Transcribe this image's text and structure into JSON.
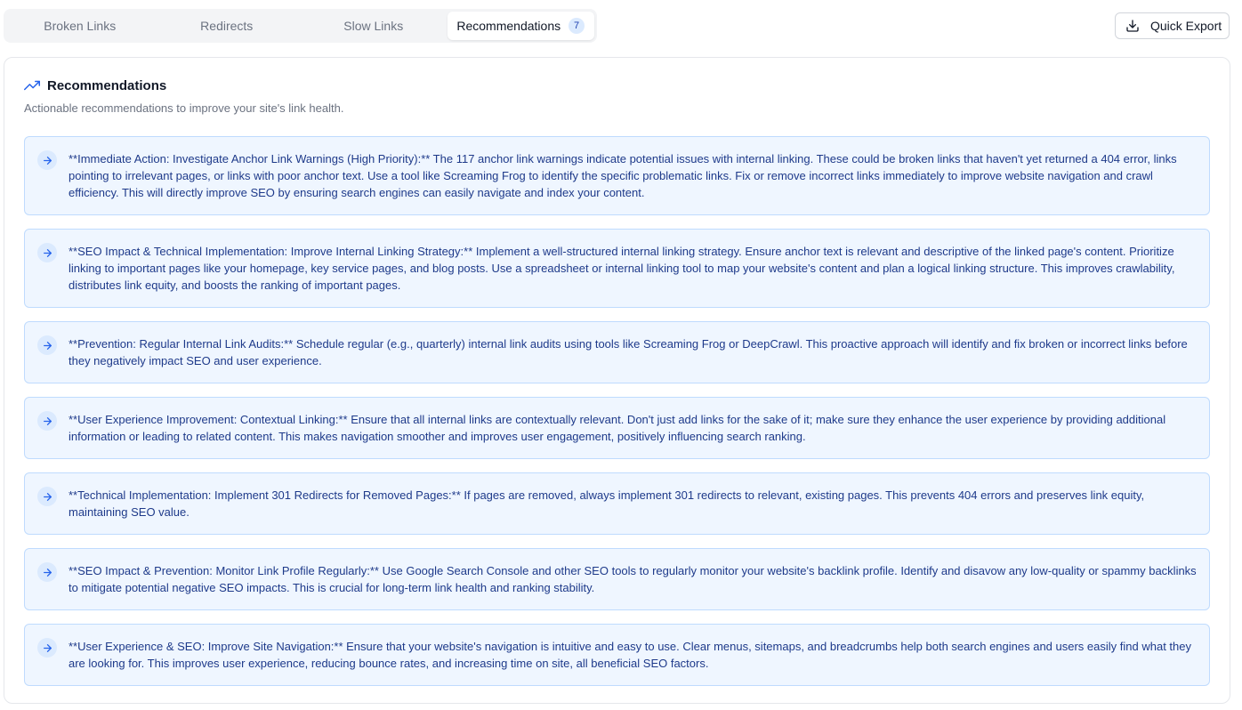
{
  "tabs": [
    {
      "label": "Broken Links"
    },
    {
      "label": "Redirects"
    },
    {
      "label": "Slow Links"
    },
    {
      "label": "Recommendations",
      "badge": "7"
    }
  ],
  "export": {
    "label": "Quick Export"
  },
  "card": {
    "title": "Recommendations",
    "subtitle": "Actionable recommendations to improve your site's link health."
  },
  "recommendations": [
    "**Immediate Action: Investigate Anchor Link Warnings (High Priority):** The 117 anchor link warnings indicate potential issues with internal linking. These could be broken links that haven't yet returned a 404 error, links pointing to irrelevant pages, or links with poor anchor text. Use a tool like Screaming Frog to identify the specific problematic links. Fix or remove incorrect links immediately to improve website navigation and crawl efficiency. This will directly improve SEO by ensuring search engines can easily navigate and index your content.",
    "**SEO Impact & Technical Implementation: Improve Internal Linking Strategy:** Implement a well-structured internal linking strategy. Ensure anchor text is relevant and descriptive of the linked page's content. Prioritize linking to important pages like your homepage, key service pages, and blog posts. Use a spreadsheet or internal linking tool to map your website's content and plan a logical linking structure. This improves crawlability, distributes link equity, and boosts the ranking of important pages.",
    "**Prevention: Regular Internal Link Audits:** Schedule regular (e.g., quarterly) internal link audits using tools like Screaming Frog or DeepCrawl. This proactive approach will identify and fix broken or incorrect links before they negatively impact SEO and user experience.",
    "**User Experience Improvement: Contextual Linking:** Ensure that all internal links are contextually relevant. Don't just add links for the sake of it; make sure they enhance the user experience by providing additional information or leading to related content. This makes navigation smoother and improves user engagement, positively influencing search ranking.",
    "**Technical Implementation: Implement 301 Redirects for Removed Pages:** If pages are removed, always implement 301 redirects to relevant, existing pages. This prevents 404 errors and preserves link equity, maintaining SEO value.",
    "**SEO Impact & Prevention: Monitor Link Profile Regularly:** Use Google Search Console and other SEO tools to regularly monitor your website's backlink profile. Identify and disavow any low-quality or spammy backlinks to mitigate potential negative SEO impacts. This is crucial for long-term link health and ranking stability.",
    "**User Experience & SEO: Improve Site Navigation:** Ensure that your website's navigation is intuitive and easy to use. Clear menus, sitemaps, and breadcrumbs help both search engines and users easily find what they are looking for. This improves user experience, reducing bounce rates, and increasing time on site, all beneficial SEO factors."
  ],
  "colors": {
    "accent": "#2563eb",
    "rec_bg": "#eff6ff",
    "rec_border": "#bfdbfe",
    "rec_text": "#1e3a8a"
  },
  "icons": {
    "export": "download-icon",
    "title": "trending-up-icon",
    "item": "arrow-right-icon"
  }
}
